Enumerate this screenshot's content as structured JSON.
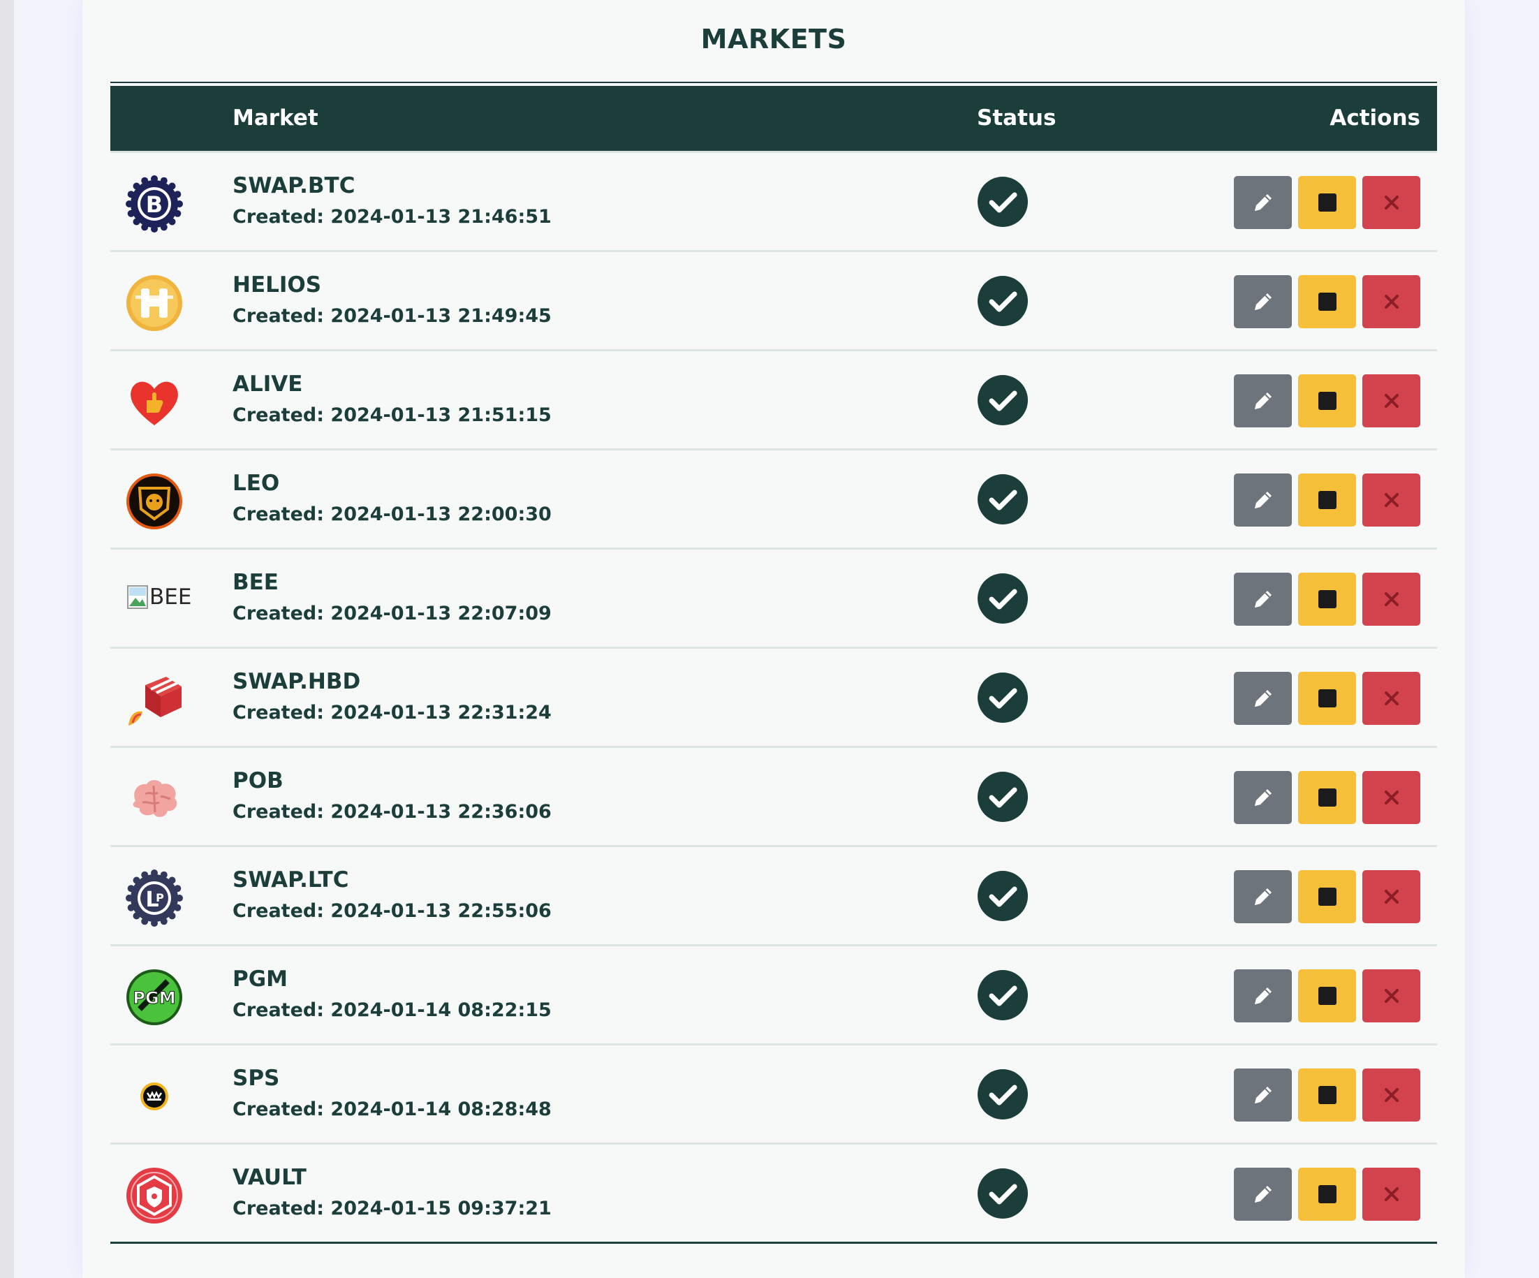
{
  "page": {
    "title": "MARKETS"
  },
  "table": {
    "headers": {
      "market": "Market",
      "status": "Status",
      "actions": "Actions"
    },
    "rows": [
      {
        "name": "SWAP.BTC",
        "created": "Created: 2024-01-13 21:46:51",
        "logo": "swap-btc-logo"
      },
      {
        "name": "HELIOS",
        "created": "Created: 2024-01-13 21:49:45",
        "logo": "helios-logo"
      },
      {
        "name": "ALIVE",
        "created": "Created: 2024-01-13 21:51:15",
        "logo": "alive-logo"
      },
      {
        "name": "LEO",
        "created": "Created: 2024-01-13 22:00:30",
        "logo": "leo-logo"
      },
      {
        "name": "BEE",
        "created": "Created: 2024-01-13 22:07:09",
        "logo": "broken-image",
        "alt": "BEE"
      },
      {
        "name": "SWAP.HBD",
        "created": "Created: 2024-01-13 22:31:24",
        "logo": "swap-hbd-logo"
      },
      {
        "name": "POB",
        "created": "Created: 2024-01-13 22:36:06",
        "logo": "pob-logo"
      },
      {
        "name": "SWAP.LTC",
        "created": "Created: 2024-01-13 22:55:06",
        "logo": "swap-ltc-logo"
      },
      {
        "name": "PGM",
        "created": "Created: 2024-01-14 08:22:15",
        "logo": "pgm-logo",
        "logo_text": "PGM"
      },
      {
        "name": "SPS",
        "created": "Created: 2024-01-14 08:28:48",
        "logo": "sps-logo"
      },
      {
        "name": "VAULT",
        "created": "Created: 2024-01-15 09:37:21",
        "logo": "vault-logo"
      }
    ]
  },
  "icons": {
    "status": "check-circle-icon",
    "edit": "pencil-icon",
    "stop": "stop-square-icon",
    "delete": "close-x-icon"
  },
  "colors": {
    "header_bg": "#1c3e3b",
    "text": "#1c3e3b",
    "edit_btn": "#6e747b",
    "stop_btn": "#f5bf3a",
    "delete_btn": "#d2434d"
  }
}
